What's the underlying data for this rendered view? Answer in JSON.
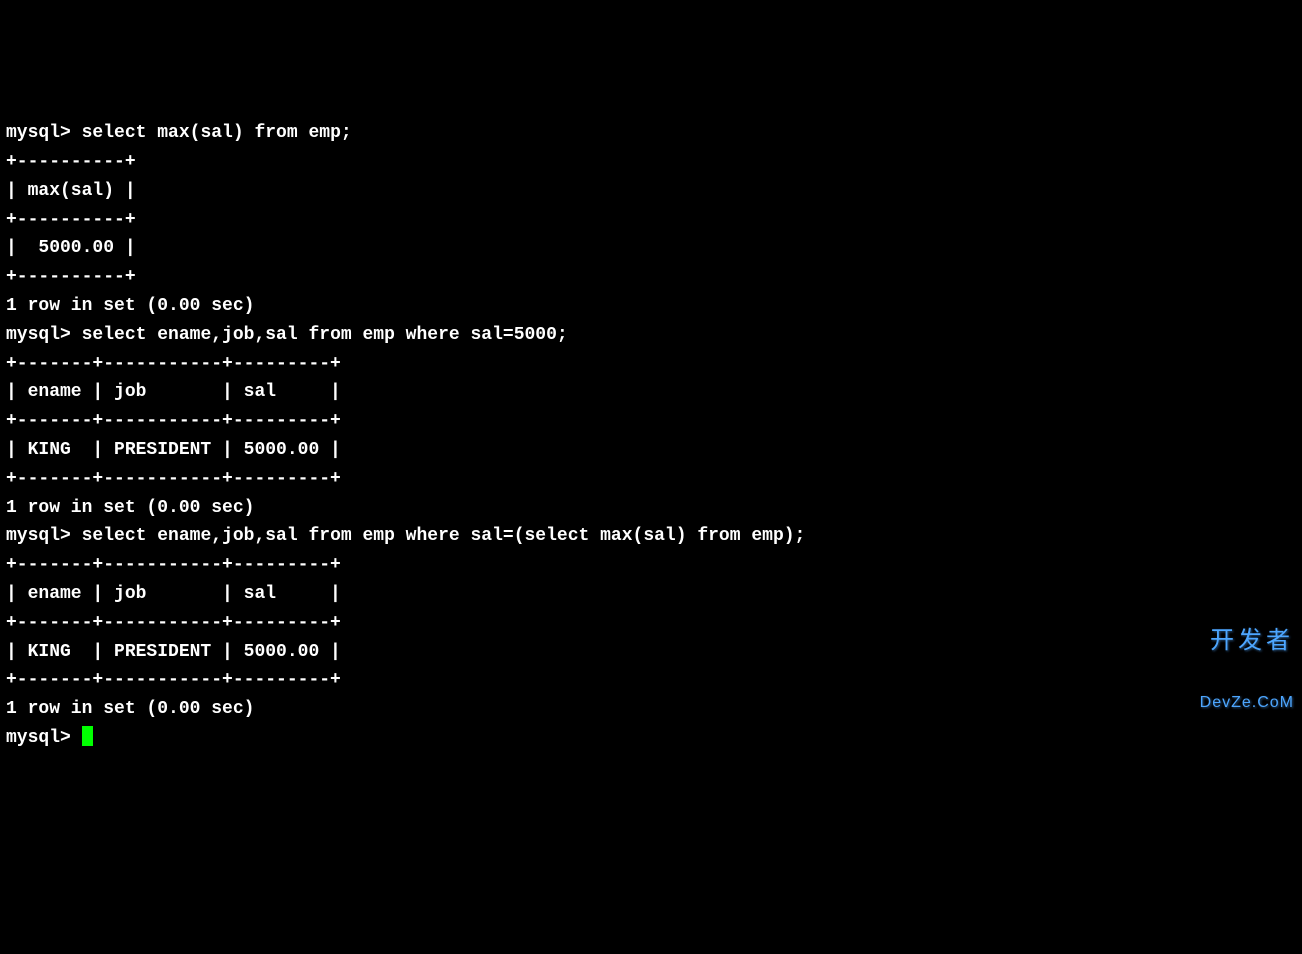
{
  "blocks": [
    {
      "prompt": "mysql> ",
      "command": "select max(sal) from emp;",
      "output": [
        "+----------+",
        "| max(sal) |",
        "+----------+",
        "|  5000.00 |",
        "+----------+",
        "1 row in set (0.00 sec)",
        ""
      ]
    },
    {
      "prompt": "mysql> ",
      "command": "select ename,job,sal from emp where sal=5000;",
      "output": [
        "+-------+-----------+---------+",
        "| ename | job       | sal     |",
        "+-------+-----------+---------+",
        "| KING  | PRESIDENT | 5000.00 |",
        "+-------+-----------+---------+",
        "1 row in set (0.00 sec)",
        ""
      ]
    },
    {
      "prompt": "mysql> ",
      "command": "select ename,job,sal from emp where sal=(select max(sal) from emp);",
      "output": [
        "+-------+-----------+---------+",
        "| ename | job       | sal     |",
        "+-------+-----------+---------+",
        "| KING  | PRESIDENT | 5000.00 |",
        "+-------+-----------+---------+",
        "1 row in set (0.00 sec)",
        ""
      ]
    }
  ],
  "final_prompt": "mysql> ",
  "watermark": {
    "top": "开发者",
    "bottom": "DevZe.CoM"
  }
}
